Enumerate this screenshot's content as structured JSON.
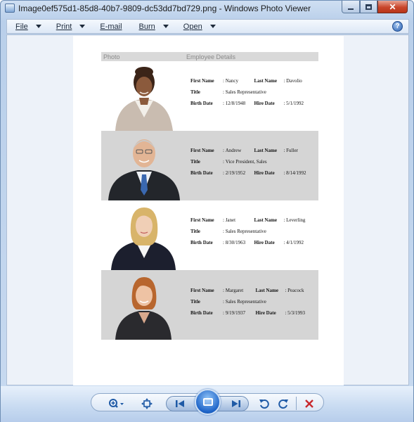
{
  "window": {
    "title": "Image0ef575d1-85d8-40b7-9809-dc53dd7bd729.png - Windows Photo Viewer"
  },
  "menu": {
    "items": [
      {
        "label": "File",
        "has_dropdown": true
      },
      {
        "label": "Print",
        "has_dropdown": true
      },
      {
        "label": "E-mail",
        "has_dropdown": false
      },
      {
        "label": "Burn",
        "has_dropdown": true
      },
      {
        "label": "Open",
        "has_dropdown": true
      }
    ],
    "help_icon": "help-icon"
  },
  "report": {
    "header": {
      "photo": "Photo",
      "details": "Employee Details"
    },
    "labels": {
      "first_name": "First Name",
      "last_name": "Last Name",
      "title": "Title",
      "birth_date": "Birth Date",
      "hire_date": "Hire Date",
      "sep": ":"
    },
    "employees": [
      {
        "first_name": "Nancy",
        "last_name": "Davolio",
        "title": "Sales Representative",
        "birth_date": "12/8/1948",
        "hire_date": "5/1/1992",
        "shaded": false
      },
      {
        "first_name": "Andrew",
        "last_name": "Fuller",
        "title": "Vice President, Sales",
        "birth_date": "2/19/1952",
        "hire_date": "8/14/1992",
        "shaded": true
      },
      {
        "first_name": "Janet",
        "last_name": "Leverling",
        "title": "Sales Representative",
        "birth_date": "8/30/1963",
        "hire_date": "4/1/1992",
        "shaded": false
      },
      {
        "first_name": "Margaret",
        "last_name": "Peacock",
        "title": "Sales Representative",
        "birth_date": "9/19/1937",
        "hire_date": "5/3/1993",
        "shaded": true
      }
    ]
  },
  "toolbar": {
    "icons": [
      "zoom-icon",
      "actual-size-icon",
      "previous-icon",
      "slideshow-icon",
      "next-icon",
      "rotate-counterclockwise-icon",
      "rotate-clockwise-icon",
      "delete-icon"
    ]
  },
  "colors": {
    "accent_blue": "#1f5aa6",
    "delete_red": "#c8282c",
    "row_shade": "#d5d5d5",
    "header_bg": "#d9d9d9"
  }
}
